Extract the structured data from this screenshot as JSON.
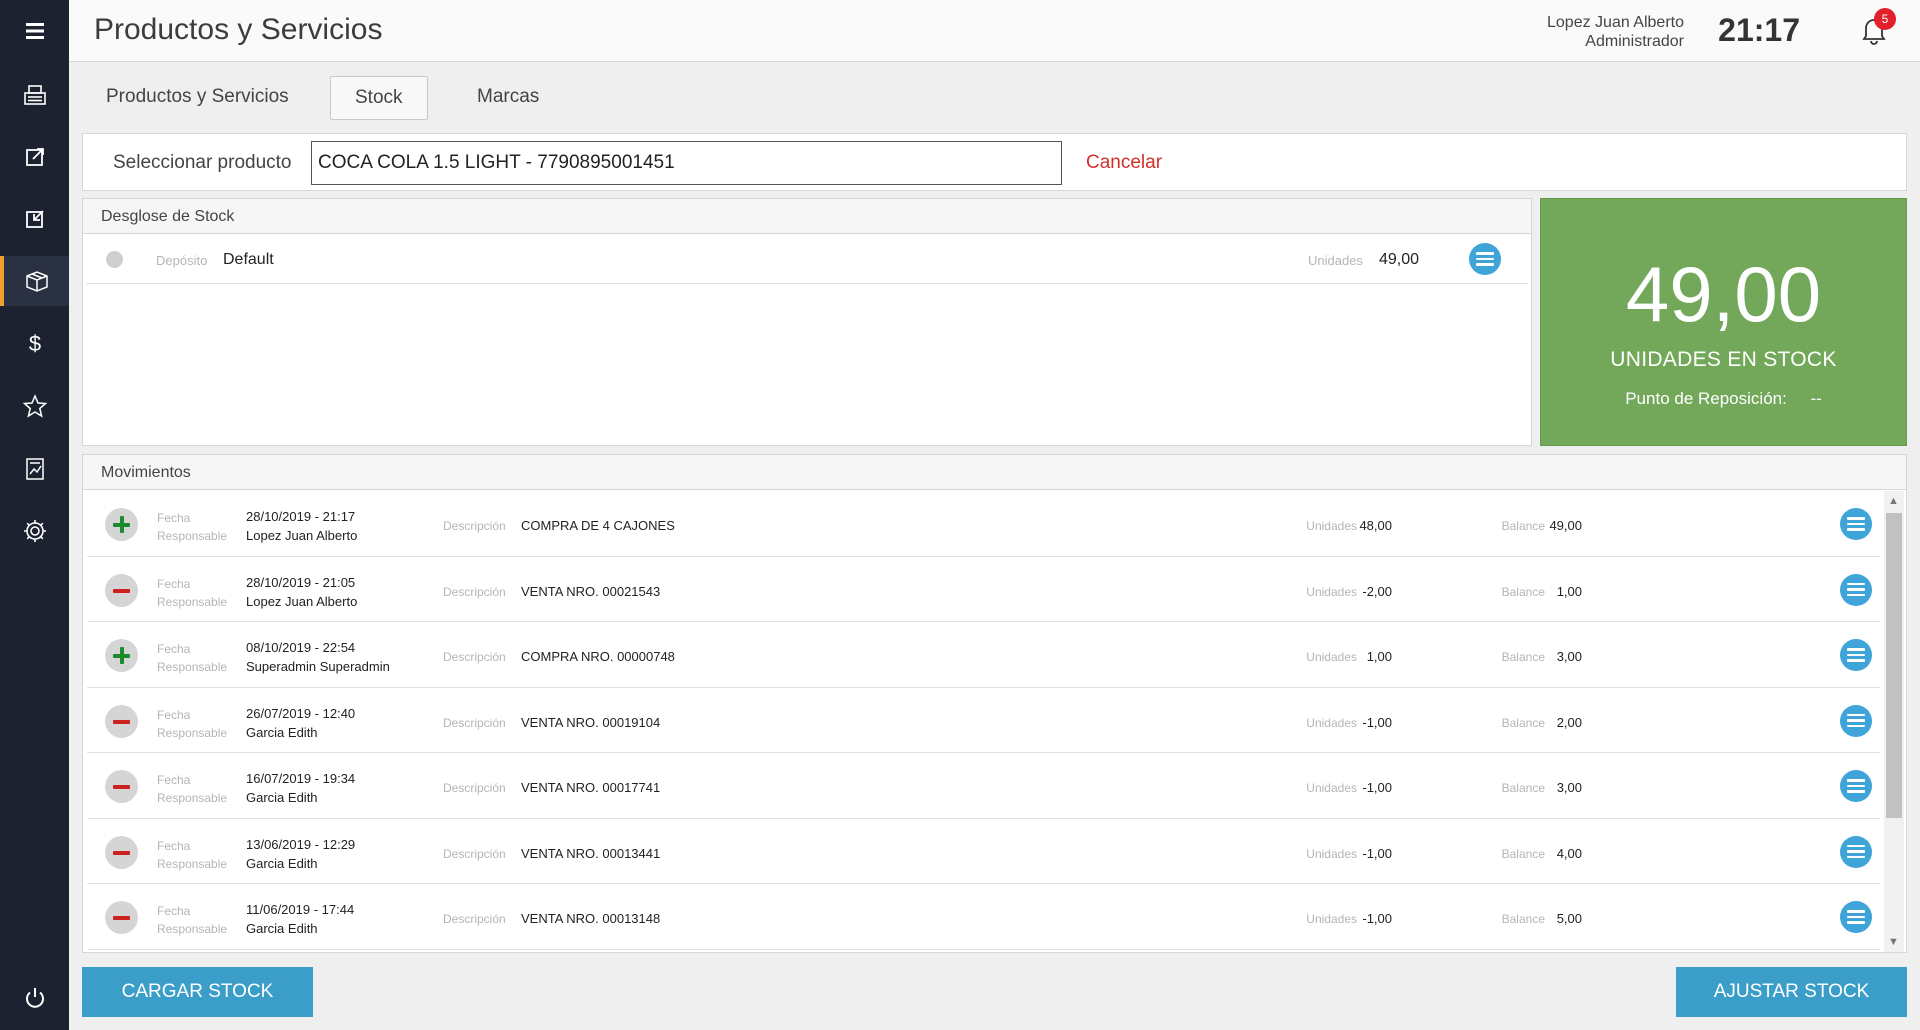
{
  "header": {
    "title": "Productos y Servicios",
    "user_name": "Lopez Juan Alberto",
    "user_role": "Administrador",
    "time": "21:17",
    "notifications": "5"
  },
  "tabs": [
    {
      "label": "Productos y Servicios",
      "active": false
    },
    {
      "label": "Stock",
      "active": true
    },
    {
      "label": "Marcas",
      "active": false
    }
  ],
  "selector": {
    "label": "Seleccionar producto",
    "value": "COCA COLA 1.5 LIGHT - 7790895001451",
    "cancel": "Cancelar"
  },
  "desglose": {
    "title": "Desglose de Stock",
    "rows": [
      {
        "deposito_label": "Depósito",
        "deposito": "Default",
        "unidades_label": "Unidades",
        "unidades": "49,00"
      }
    ]
  },
  "summary": {
    "value": "49,00",
    "label": "UNIDADES EN STOCK",
    "reposicion_label": "Punto de Reposición:",
    "reposicion_value": "--",
    "color": "#73a85a"
  },
  "movimientos": {
    "title": "Movimientos",
    "labels": {
      "fecha": "Fecha",
      "responsable": "Responsable",
      "descripcion": "Descripción",
      "unidades": "Unidades",
      "balance": "Balance"
    },
    "rows": [
      {
        "type": "plus",
        "fecha": "28/10/2019 - 21:17",
        "responsable": "Lopez Juan Alberto",
        "descripcion": "COMPRA DE 4 CAJONES",
        "unidades": "48,00",
        "balance": "49,00"
      },
      {
        "type": "minus",
        "fecha": "28/10/2019 - 21:05",
        "responsable": "Lopez Juan Alberto",
        "descripcion": "VENTA NRO. 00021543",
        "unidades": "-2,00",
        "balance": "1,00"
      },
      {
        "type": "plus",
        "fecha": "08/10/2019 - 22:54",
        "responsable": "Superadmin Superadmin",
        "descripcion": "COMPRA NRO. 00000748",
        "unidades": "1,00",
        "balance": "3,00"
      },
      {
        "type": "minus",
        "fecha": "26/07/2019 - 12:40",
        "responsable": "Garcia Edith",
        "descripcion": "VENTA NRO. 00019104",
        "unidades": "-1,00",
        "balance": "2,00"
      },
      {
        "type": "minus",
        "fecha": "16/07/2019 - 19:34",
        "responsable": "Garcia Edith",
        "descripcion": "VENTA NRO. 00017741",
        "unidades": "-1,00",
        "balance": "3,00"
      },
      {
        "type": "minus",
        "fecha": "13/06/2019 - 12:29",
        "responsable": "Garcia Edith",
        "descripcion": "VENTA NRO. 00013441",
        "unidades": "-1,00",
        "balance": "4,00"
      },
      {
        "type": "minus",
        "fecha": "11/06/2019 - 17:44",
        "responsable": "Garcia Edith",
        "descripcion": "VENTA NRO. 00013148",
        "unidades": "-1,00",
        "balance": "5,00"
      }
    ]
  },
  "buttons": {
    "cargar": "CARGAR STOCK",
    "ajustar": "AJUSTAR STOCK"
  },
  "sidebar": {
    "items": [
      "menu-icon",
      "register-icon",
      "export-icon",
      "import-icon",
      "box-icon",
      "dollar-icon",
      "star-icon",
      "report-icon",
      "gear-icon",
      "power-icon"
    ]
  }
}
